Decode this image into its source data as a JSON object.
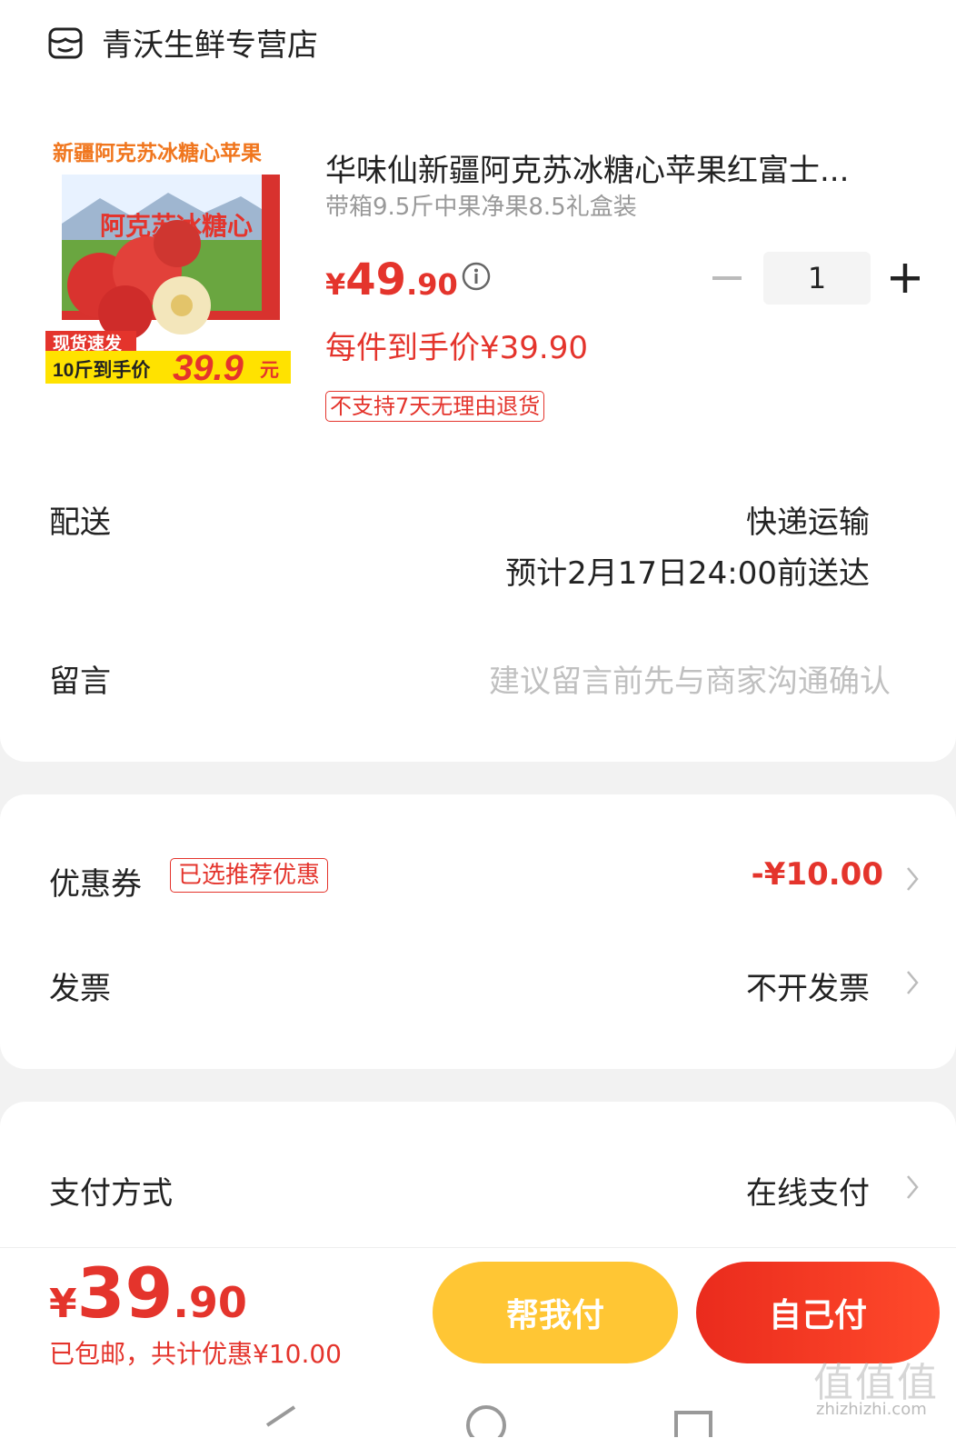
{
  "store": {
    "name": "青沃生鲜专营店",
    "icon": "store-icon"
  },
  "product": {
    "title": "华味仙新疆阿克苏冰糖心苹果红富士...",
    "spec": "带箱9.5斤中果净果8.5礼盒装",
    "price_currency": "¥",
    "price_int": "49",
    "price_dec": ".90",
    "per_price": "每件到手价¥39.90",
    "return_policy": "不支持7天无理由退货",
    "quantity": "1",
    "image": {
      "headline": "新疆阿克苏冰糖心苹果",
      "box_text": "阿克苏冰糖心",
      "tag": "现货速发",
      "promo": "10斤到手价",
      "promo_price": "39.9",
      "promo_unit": "元"
    }
  },
  "delivery": {
    "label": "配送",
    "method": "快递运输",
    "eta": "预计2月17日24:00前送达"
  },
  "message": {
    "label": "留言",
    "placeholder": "建议留言前先与商家沟通确认"
  },
  "coupon": {
    "label": "优惠券",
    "badge": "已选推荐优惠",
    "value": "-¥10.00"
  },
  "invoice": {
    "label": "发票",
    "value": "不开发票"
  },
  "payment": {
    "label": "支付方式",
    "value": "在线支付"
  },
  "bottom": {
    "currency": "¥",
    "total_int": "39",
    "total_dec": ".90",
    "note": "已包邮，共计优惠¥10.00",
    "help_pay": "帮我付",
    "self_pay": "自己付"
  },
  "watermark": {
    "main": "值值值",
    "sub": "zhizhizhi.com"
  },
  "colors": {
    "accent": "#e4342c",
    "help_button": "#ffc634",
    "self_button": "#ea2b1d"
  }
}
